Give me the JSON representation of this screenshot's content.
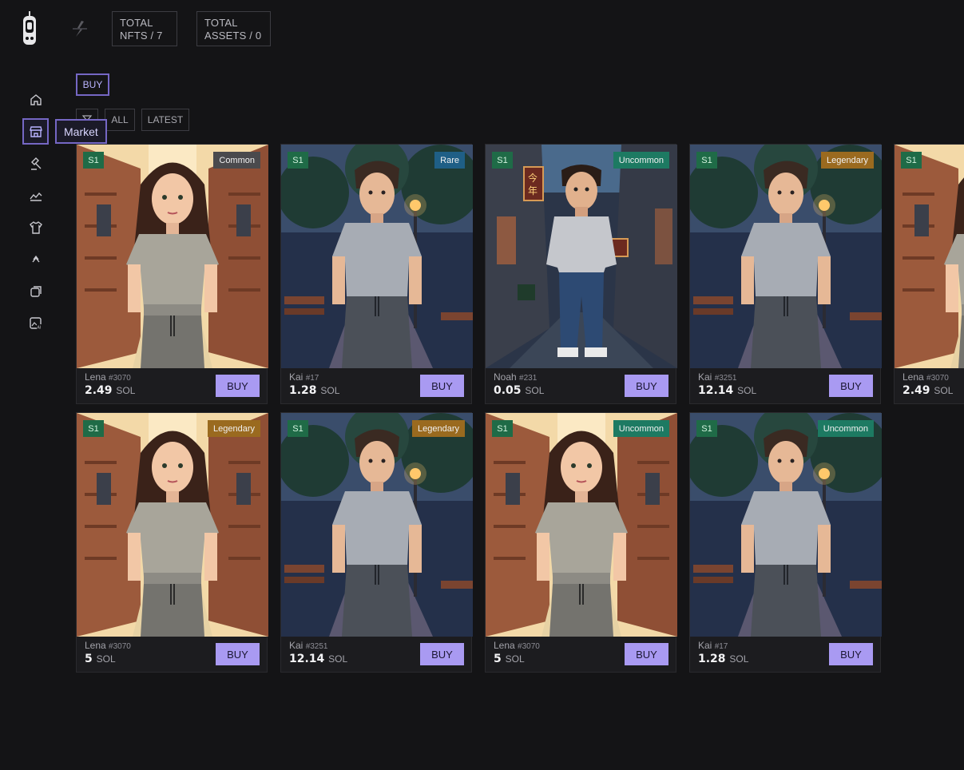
{
  "header": {
    "stats": [
      {
        "line1": "TOTAL",
        "line2": "NFTS / 7"
      },
      {
        "line1": "TOTAL",
        "line2": "ASSETS / 0"
      }
    ]
  },
  "nav": {
    "items": [
      "home-icon",
      "market-icon",
      "auction-icon",
      "chart-icon",
      "shirt-icon",
      "rank-icon",
      "collection-icon",
      "ai-image-icon"
    ],
    "active_tooltip": "Market"
  },
  "tabs": {
    "buy": "BUY"
  },
  "filters": {
    "all": "ALL",
    "latest": "LATEST"
  },
  "colors": {
    "accent": "#7567c4",
    "button": "#a99af2",
    "season": "#1f6b47",
    "common": "#4a4a4d",
    "rare": "#1f5f86",
    "uncommon": "#1d7a62",
    "legendary": "#9a6a1f"
  },
  "cards": [
    {
      "season": "S1",
      "rarity": "Common",
      "name": "Lena",
      "id": "#3070",
      "price": "2.49",
      "unit": "SOL",
      "buy": "BUY",
      "art": "lena"
    },
    {
      "season": "S1",
      "rarity": "Rare",
      "name": "Kai",
      "id": "#17",
      "price": "1.28",
      "unit": "SOL",
      "buy": "BUY",
      "art": "kai"
    },
    {
      "season": "S1",
      "rarity": "Uncommon",
      "name": "Noah",
      "id": "#231",
      "price": "0.05",
      "unit": "SOL",
      "buy": "BUY",
      "art": "noah"
    },
    {
      "season": "S1",
      "rarity": "Legendary",
      "name": "Kai",
      "id": "#3251",
      "price": "12.14",
      "unit": "SOL",
      "buy": "BUY",
      "art": "kai"
    },
    {
      "season": "S1",
      "rarity": "",
      "name": "Lena",
      "id": "#3070",
      "price": "2.49",
      "unit": "SOL",
      "buy": "",
      "art": "lena"
    },
    {
      "season": "S1",
      "rarity": "Legendary",
      "name": "Lena",
      "id": "#3070",
      "price": "5",
      "unit": "SOL",
      "buy": "BUY",
      "art": "lena"
    },
    {
      "season": "S1",
      "rarity": "Legendary",
      "name": "Kai",
      "id": "#3251",
      "price": "12.14",
      "unit": "SOL",
      "buy": "BUY",
      "art": "kai"
    },
    {
      "season": "S1",
      "rarity": "Uncommon",
      "name": "Lena",
      "id": "#3070",
      "price": "5",
      "unit": "SOL",
      "buy": "BUY",
      "art": "lena"
    },
    {
      "season": "S1",
      "rarity": "Uncommon",
      "name": "Kai",
      "id": "#17",
      "price": "1.28",
      "unit": "SOL",
      "buy": "BUY",
      "art": "kai"
    }
  ]
}
